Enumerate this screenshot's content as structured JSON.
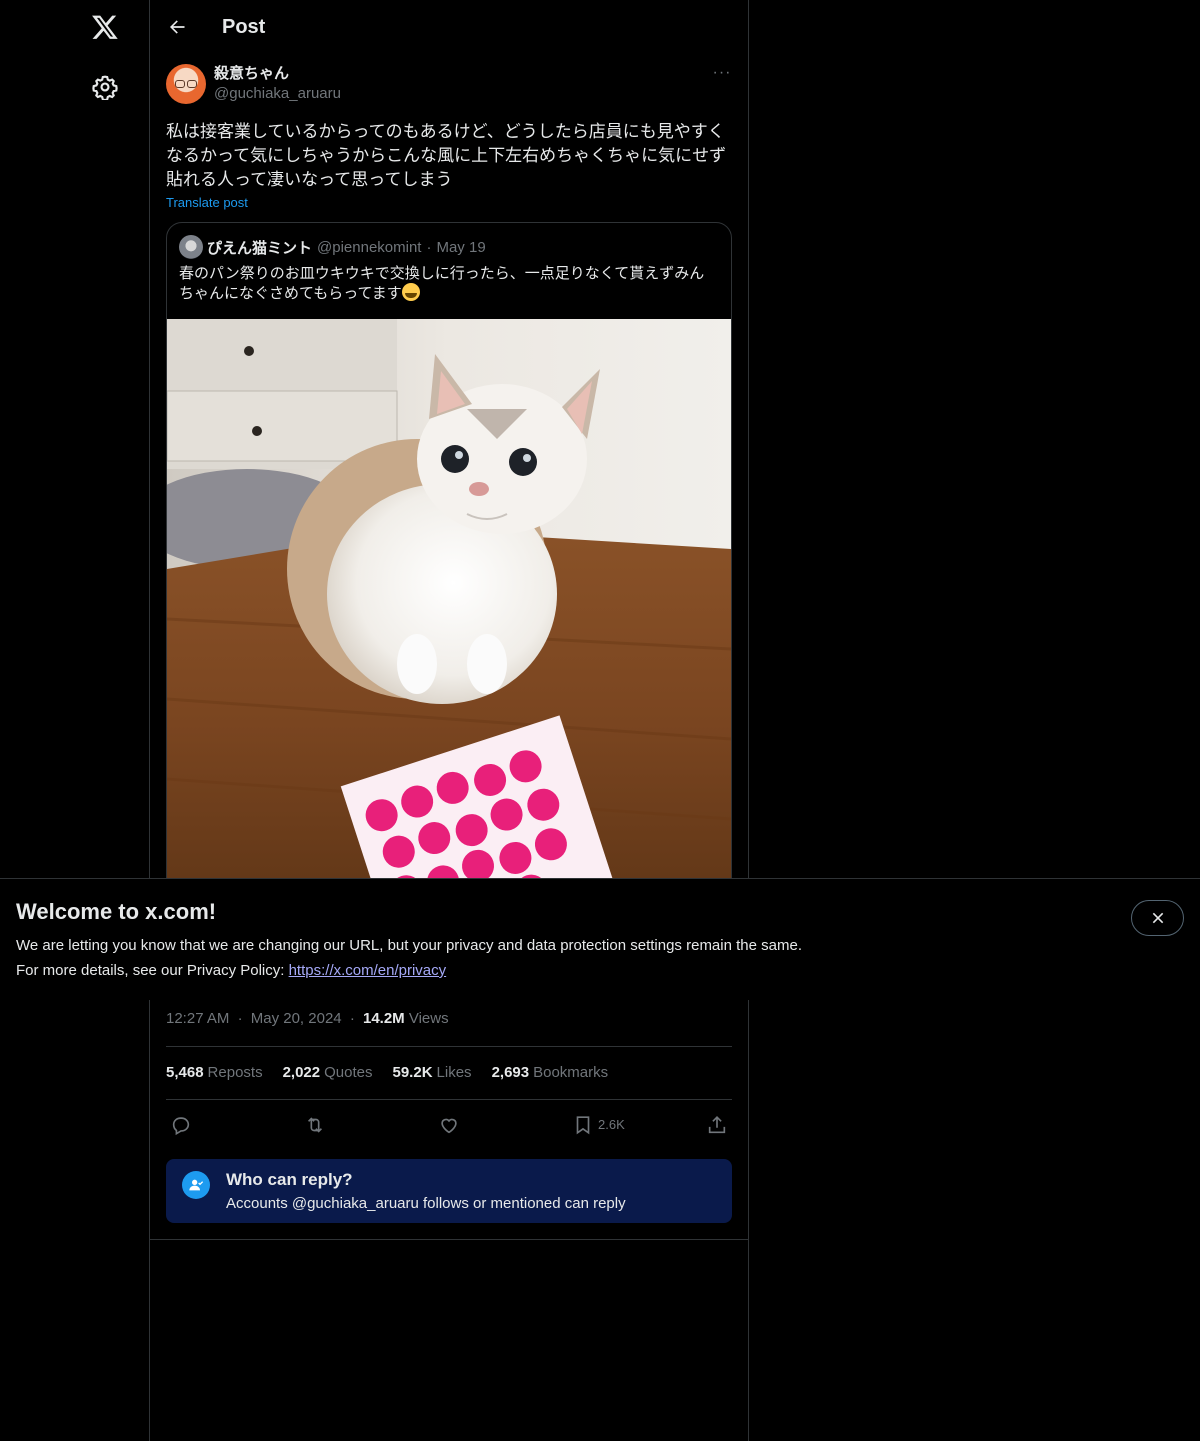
{
  "header": {
    "title": "Post"
  },
  "post": {
    "display_name": "殺意ちゃん",
    "handle": "@guchiaka_aruaru",
    "text": "私は接客業しているからってのもあるけど、どうしたら店員にも見やすく\nなるかって気にしちゃうからこんな風に上下左右めちゃくちゃに気にせず\n貼れる人って凄いなって思ってしまう",
    "translate_label": "Translate post",
    "more_label": "···"
  },
  "quote": {
    "display_name": "ぴえん猫ミント",
    "handle": "@piennekomint",
    "dot": "·",
    "date": "May 19",
    "text": "春のパン祭りのお皿ウキウキで交換しに行ったら、一点足りなくて貰えずみん\nちゃんになぐさめてもらってます"
  },
  "meta": {
    "time": "12:27 AM",
    "dot": "·",
    "date": "May 20, 2024",
    "views_count": "14.2M",
    "views_label": "Views"
  },
  "stats": [
    {
      "num": "5,468",
      "label": "Reposts"
    },
    {
      "num": "2,022",
      "label": "Quotes"
    },
    {
      "num": "59.2K",
      "label": "Likes"
    },
    {
      "num": "2,693",
      "label": "Bookmarks"
    }
  ],
  "actions": {
    "bookmark_count": "2.6K"
  },
  "reply_info": {
    "title": "Who can reply?",
    "subtitle": "Accounts @guchiaka_aruaru follows or mentioned can reply"
  },
  "welcome": {
    "title": "Welcome to x.com!",
    "line1": "We are letting you know that we are changing our URL, but your privacy and data protection settings remain the same.",
    "line2_prefix": "For more details, see our Privacy Policy: ",
    "link": "https://x.com/en/privacy"
  },
  "colors": {
    "accent": "#1d9bf0",
    "reply_bg": "#0a1a4b",
    "border": "#2f3336",
    "muted": "#71767b"
  },
  "icons": [
    "x-logo-icon",
    "gear-icon",
    "back-arrow-icon",
    "reply-icon",
    "repost-icon",
    "like-icon",
    "bookmark-icon",
    "share-icon",
    "close-icon",
    "person-check-icon"
  ]
}
